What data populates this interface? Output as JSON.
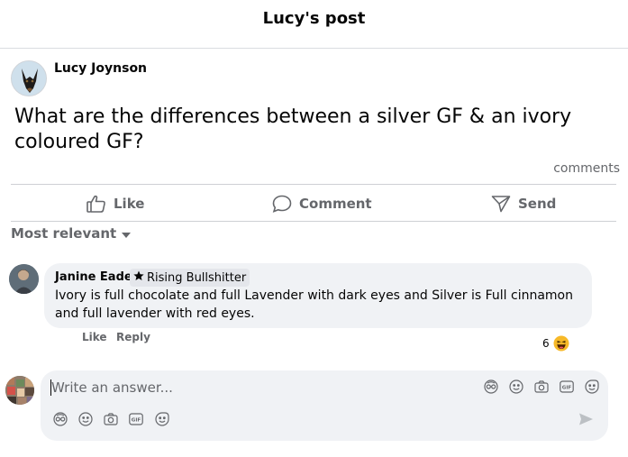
{
  "header": {
    "title": "Lucy's post"
  },
  "post": {
    "author": "Lucy Joynson",
    "text": "What are the differences between a silver GF & an ivory coloured GF?",
    "comments_label": "comments"
  },
  "actions": {
    "like": "Like",
    "comment": "Comment",
    "send": "Send"
  },
  "sort": {
    "label": "Most relevant"
  },
  "comment": {
    "author": "Janine Eades",
    "badge": "Rising Bullshitter",
    "text": "Ivory is full chocolate and full Lavender with dark eyes and Silver is Full cinnamon and full lavender with red eyes.",
    "like": "Like",
    "reply": "Reply",
    "reaction_count": "6",
    "reaction_icon": "haha-emoji-icon"
  },
  "composer": {
    "placeholder": "Write an answer...",
    "tools": [
      "avatar-sticker-icon",
      "emoji-icon",
      "camera-icon",
      "gif-icon",
      "sticker-icon"
    ]
  },
  "colors": {
    "muted": "#65676b",
    "bubble": "#f0f2f5",
    "divider": "#ced0d4"
  }
}
